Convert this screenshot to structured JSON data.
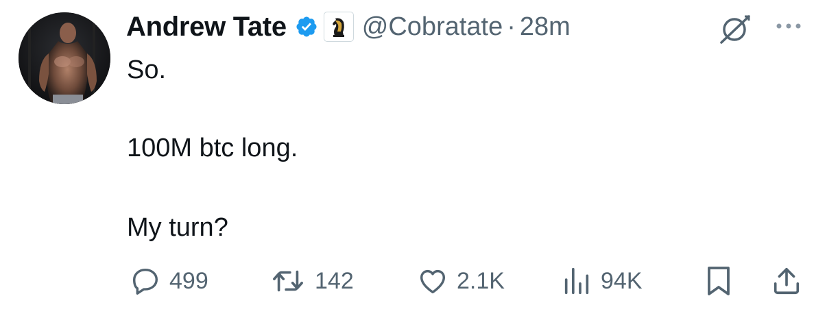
{
  "author": {
    "display_name": "Andrew Tate",
    "handle": "@Cobratate",
    "separator": "·",
    "timestamp": "28m",
    "verified_color": "#1d9bf0",
    "verified_icon": "verified-badge-icon",
    "affiliate_icon": "chess-knight-icon",
    "avatar_icon": "avatar-photo"
  },
  "tweet": {
    "lines": [
      "So.",
      "100M btc long.",
      "My turn?"
    ]
  },
  "header_icons": {
    "grok": "grok-icon",
    "more": "more-options-icon"
  },
  "actions": {
    "reply": {
      "icon": "reply-bubble-icon",
      "count": "499"
    },
    "retweet": {
      "icon": "retweet-icon",
      "count": "142"
    },
    "like": {
      "icon": "heart-icon",
      "count": "2.1K"
    },
    "views": {
      "icon": "views-bar-chart-icon",
      "count": "94K"
    },
    "bookmark": {
      "icon": "bookmark-icon"
    },
    "share": {
      "icon": "share-upload-icon"
    }
  },
  "colors": {
    "text_primary": "#0f1419",
    "text_secondary": "#536471",
    "accent": "#1d9bf0"
  }
}
